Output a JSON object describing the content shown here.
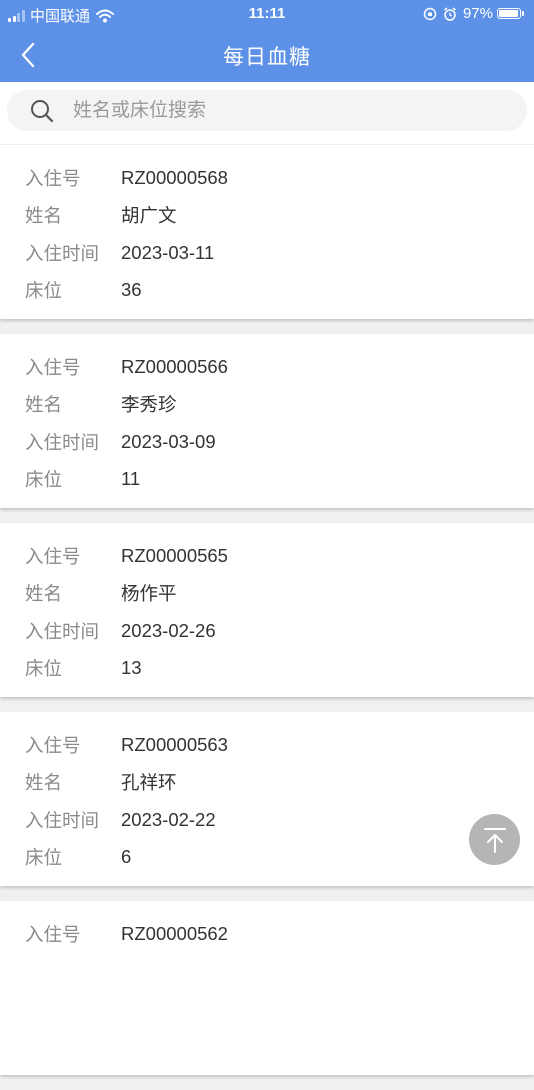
{
  "status_bar": {
    "carrier": "中国联通",
    "time": "11:11",
    "battery": "97%",
    "battery_level": 0.97
  },
  "nav": {
    "title": "每日血糖"
  },
  "search": {
    "placeholder": "姓名或床位搜索",
    "value": ""
  },
  "labels": {
    "admission_no": "入住号",
    "name": "姓名",
    "admission_time": "入住时间",
    "bed": "床位"
  },
  "records": [
    {
      "admission_no": "RZ00000568",
      "name": "胡广文",
      "admission_time": "2023-03-11",
      "bed": "36"
    },
    {
      "admission_no": "RZ00000566",
      "name": "李秀珍",
      "admission_time": "2023-03-09",
      "bed": "11"
    },
    {
      "admission_no": "RZ00000565",
      "name": "杨作平",
      "admission_time": "2023-02-26",
      "bed": "13"
    },
    {
      "admission_no": "RZ00000563",
      "name": "孔祥环",
      "admission_time": "2023-02-22",
      "bed": "6"
    },
    {
      "admission_no": "RZ00000562"
    }
  ],
  "colors": {
    "header": "#5d91e8",
    "label": "#8a8a8a",
    "value": "#333333",
    "background": "#f0f0f0"
  }
}
